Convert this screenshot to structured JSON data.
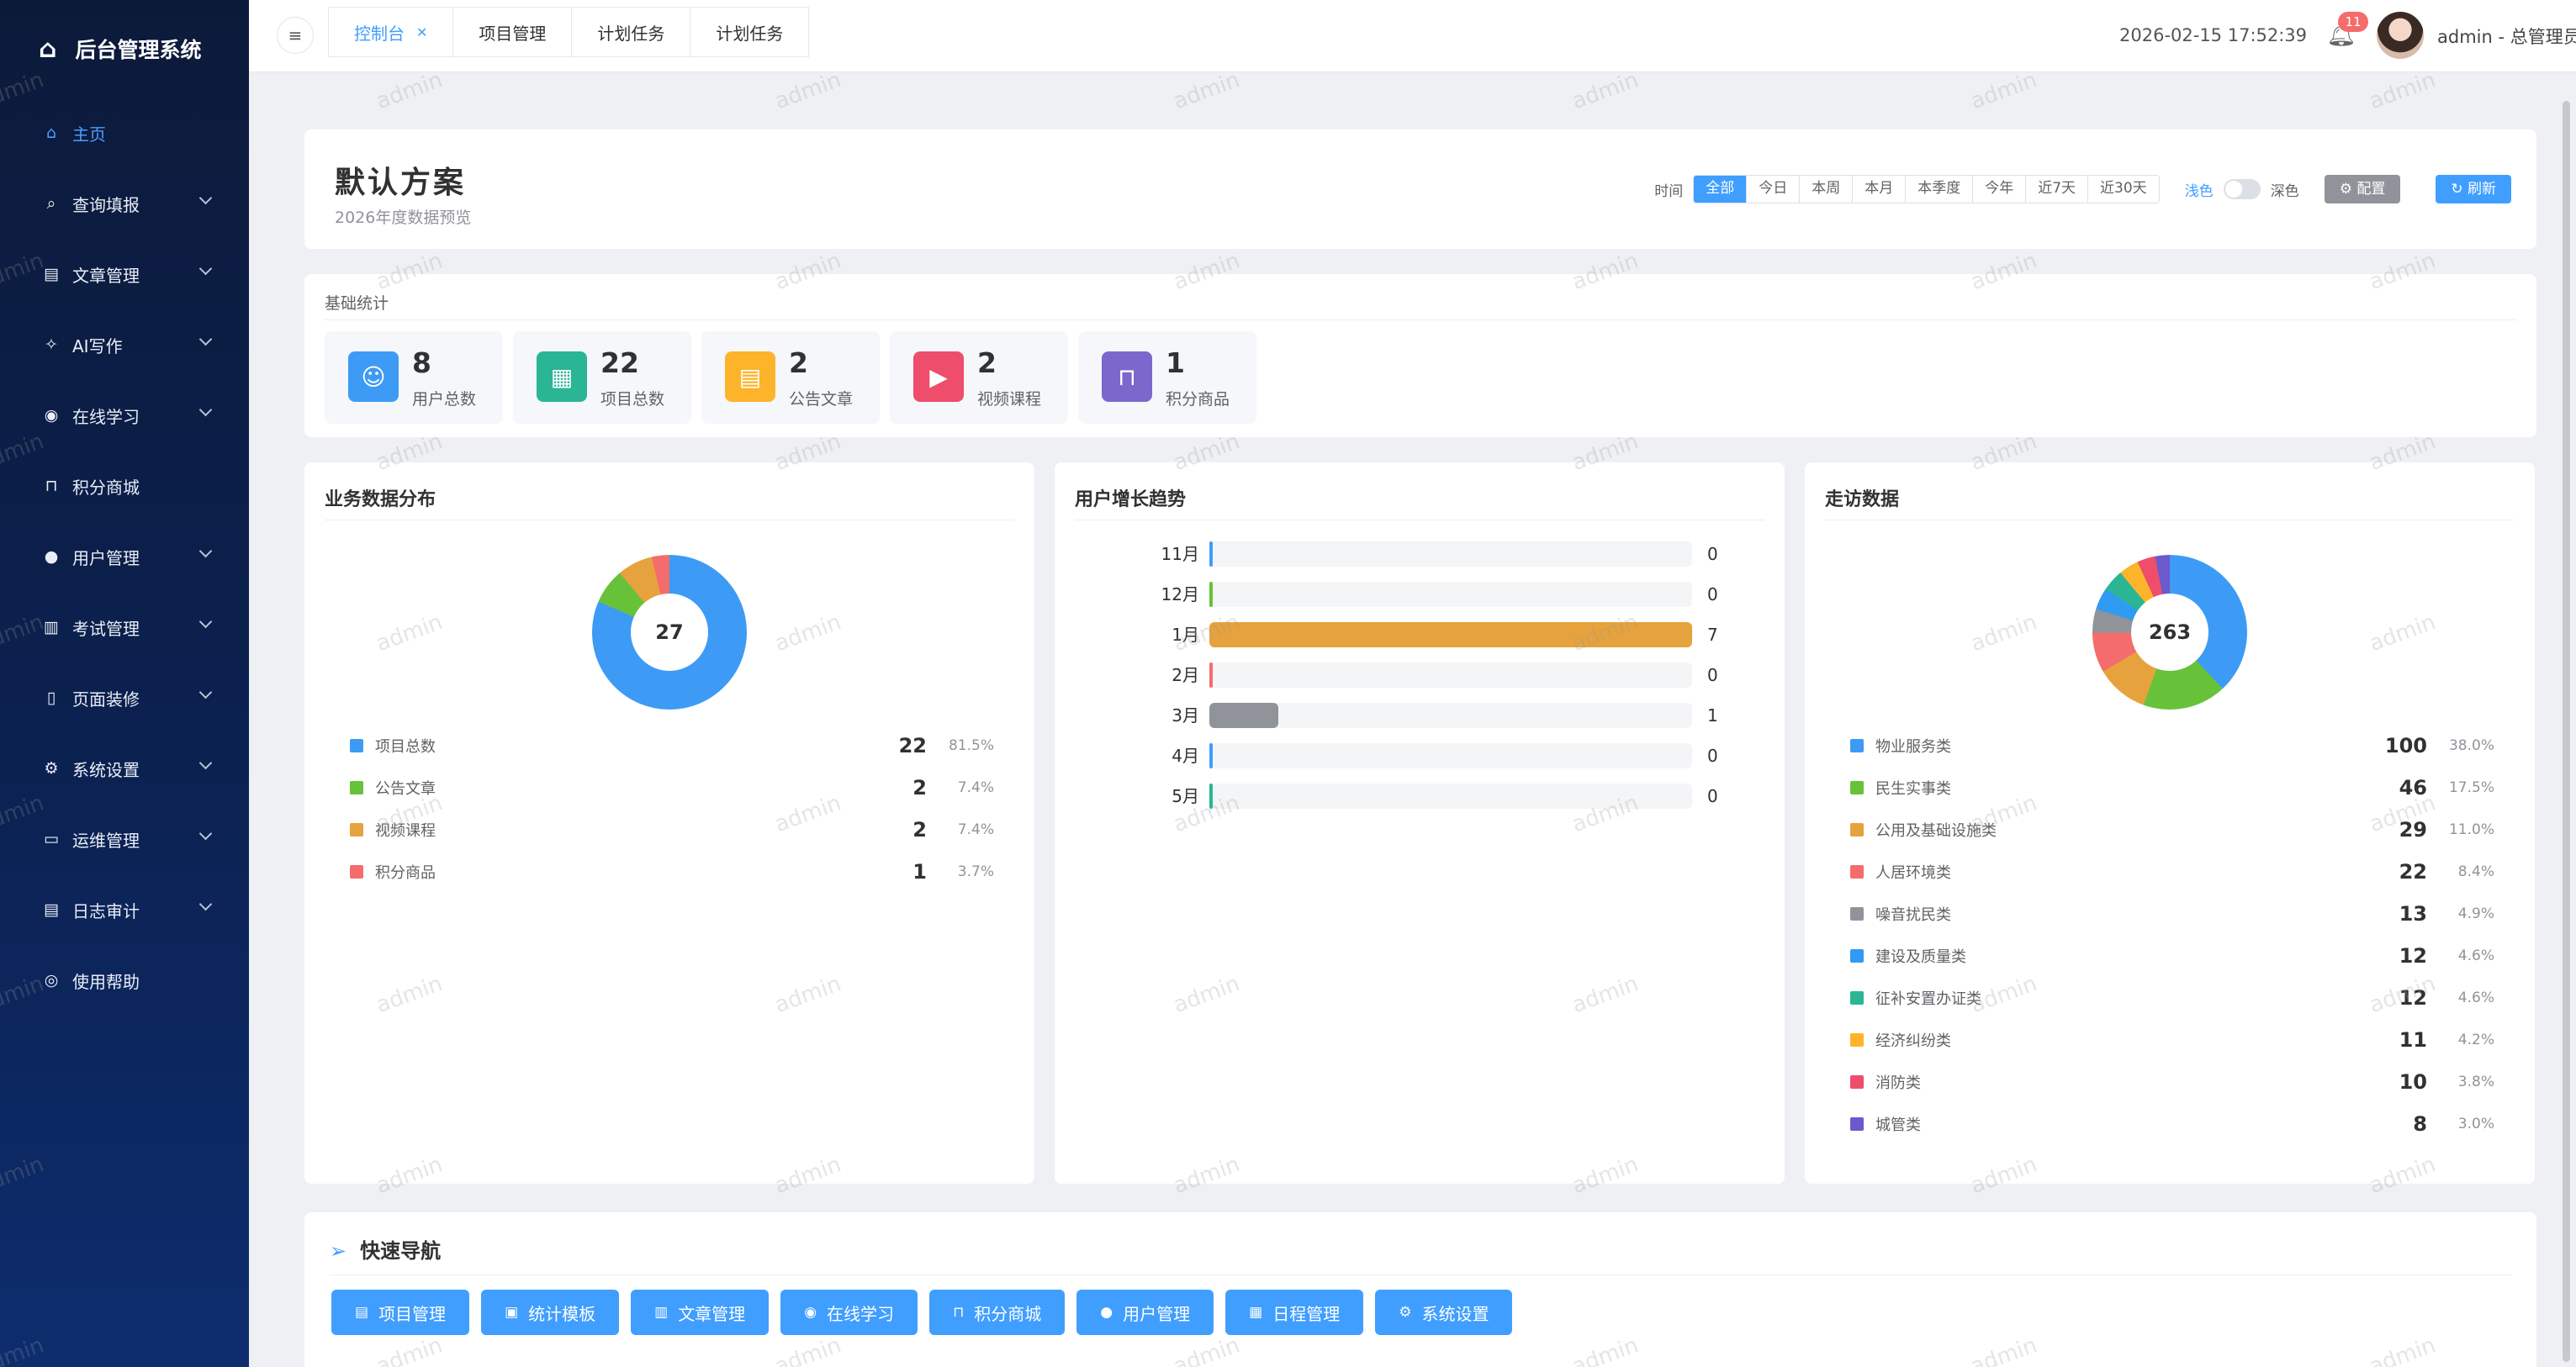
{
  "app": {
    "title": "后台管理系统"
  },
  "sidebar": {
    "items": [
      {
        "label": "主页",
        "icon": "home-icon",
        "active": true,
        "has_children": false
      },
      {
        "label": "查询填报",
        "icon": "search-icon",
        "has_children": true
      },
      {
        "label": "文章管理",
        "icon": "document-icon",
        "has_children": true
      },
      {
        "label": "AI写作",
        "icon": "ai-sparkle-icon",
        "has_children": true
      },
      {
        "label": "在线学习",
        "icon": "play-circle-icon",
        "has_children": true
      },
      {
        "label": "积分商城",
        "icon": "shopping-bag-icon",
        "has_children": false
      },
      {
        "label": "用户管理",
        "icon": "user-icon",
        "has_children": true
      },
      {
        "label": "考试管理",
        "icon": "exam-paper-icon",
        "has_children": true
      },
      {
        "label": "页面装修",
        "icon": "mobile-page-icon",
        "has_children": true
      },
      {
        "label": "系统设置",
        "icon": "gear-icon",
        "has_children": true
      },
      {
        "label": "运维管理",
        "icon": "monitor-icon",
        "has_children": true
      },
      {
        "label": "日志审计",
        "icon": "log-file-icon",
        "has_children": true
      },
      {
        "label": "使用帮助",
        "icon": "help-lifebuoy-icon",
        "has_children": false
      }
    ]
  },
  "topbar": {
    "tabs": [
      {
        "label": "控制台",
        "active": true,
        "closable": true,
        "close_glyph": "✕"
      },
      {
        "label": "项目管理"
      },
      {
        "label": "计划任务"
      },
      {
        "label": "计划任务"
      }
    ],
    "datetime": "2026-02-15 17:52:39",
    "notification_count": "11",
    "user": "admin - 总管理员"
  },
  "plan": {
    "title": "默认方案",
    "subtitle": "2026年度数据预览",
    "time_label": "时间",
    "time_filters": [
      "全部",
      "今日",
      "本周",
      "本月",
      "本季度",
      "今年",
      "近7天",
      "近30天"
    ],
    "time_selected": "全部",
    "theme_light": "浅色",
    "theme_dark": "深色",
    "config_label": "配置",
    "refresh_label": "刷新"
  },
  "stats": {
    "title": "基础统计",
    "items": [
      {
        "value": "8",
        "label": "用户总数",
        "icon": "user-icon",
        "color": "#3d9bf5"
      },
      {
        "value": "22",
        "label": "项目总数",
        "icon": "grid-icon",
        "color": "#2ab595"
      },
      {
        "value": "2",
        "label": "公告文章",
        "icon": "document-icon",
        "color": "#fdb42a"
      },
      {
        "value": "2",
        "label": "视频课程",
        "icon": "play-circle-icon",
        "color": "#ee4d6b"
      },
      {
        "value": "1",
        "label": "积分商品",
        "icon": "shopping-bag-icon",
        "color": "#7c68cc"
      }
    ]
  },
  "business": {
    "title": "业务数据分布",
    "total": "27",
    "items": [
      {
        "name": "项目总数",
        "value": "22",
        "percent": "81.5%",
        "color": "#3d9bf5"
      },
      {
        "name": "公告文章",
        "value": "2",
        "percent": "7.4%",
        "color": "#67c23a"
      },
      {
        "name": "视频课程",
        "value": "2",
        "percent": "7.4%",
        "color": "#e6a23c"
      },
      {
        "name": "积分商品",
        "value": "1",
        "percent": "3.7%",
        "color": "#f56c6c"
      }
    ]
  },
  "growth": {
    "title": "用户增长趋势",
    "max": 7,
    "rows": [
      {
        "label": "11月",
        "value": 0,
        "color": "#409eff"
      },
      {
        "label": "12月",
        "value": 0,
        "color": "#67c23a"
      },
      {
        "label": "1月",
        "value": 7,
        "color": "#e6a23c"
      },
      {
        "label": "2月",
        "value": 0,
        "color": "#f56c6c"
      },
      {
        "label": "3月",
        "value": 1,
        "color": "#909399"
      },
      {
        "label": "4月",
        "value": 0,
        "color": "#409eff"
      },
      {
        "label": "5月",
        "value": 0,
        "color": "#2ab595"
      }
    ]
  },
  "visits": {
    "title": "走访数据",
    "total": "263",
    "items": [
      {
        "name": "物业服务类",
        "value": "100",
        "percent": "38.0%",
        "color": "#3d9bf5"
      },
      {
        "name": "民生实事类",
        "value": "46",
        "percent": "17.5%",
        "color": "#67c23a"
      },
      {
        "name": "公用及基础设施类",
        "value": "29",
        "percent": "11.0%",
        "color": "#e6a23c"
      },
      {
        "name": "人居环境类",
        "value": "22",
        "percent": "8.4%",
        "color": "#f56c6c"
      },
      {
        "name": "噪音扰民类",
        "value": "13",
        "percent": "4.9%",
        "color": "#909399"
      },
      {
        "name": "建设及质量类",
        "value": "12",
        "percent": "4.6%",
        "color": "#2f9bf3"
      },
      {
        "name": "征补安置办证类",
        "value": "12",
        "percent": "4.6%",
        "color": "#2ab595"
      },
      {
        "name": "经济纠纷类",
        "value": "11",
        "percent": "4.2%",
        "color": "#fdb42a"
      },
      {
        "name": "消防类",
        "value": "10",
        "percent": "3.8%",
        "color": "#ee4d6b"
      },
      {
        "name": "城管类",
        "value": "8",
        "percent": "3.0%",
        "color": "#6a5acd"
      }
    ]
  },
  "quicknav": {
    "title": "快速导航",
    "buttons": [
      {
        "label": "项目管理",
        "icon": "document-icon"
      },
      {
        "label": "统计模板",
        "icon": "template-icon"
      },
      {
        "label": "文章管理",
        "icon": "article-icon"
      },
      {
        "label": "在线学习",
        "icon": "play-circle-icon"
      },
      {
        "label": "积分商城",
        "icon": "shopping-bag-icon"
      },
      {
        "label": "用户管理",
        "icon": "user-icon"
      },
      {
        "label": "日程管理",
        "icon": "calendar-icon"
      },
      {
        "label": "系统设置",
        "icon": "gear-icon"
      }
    ]
  },
  "watermark": "admin"
}
